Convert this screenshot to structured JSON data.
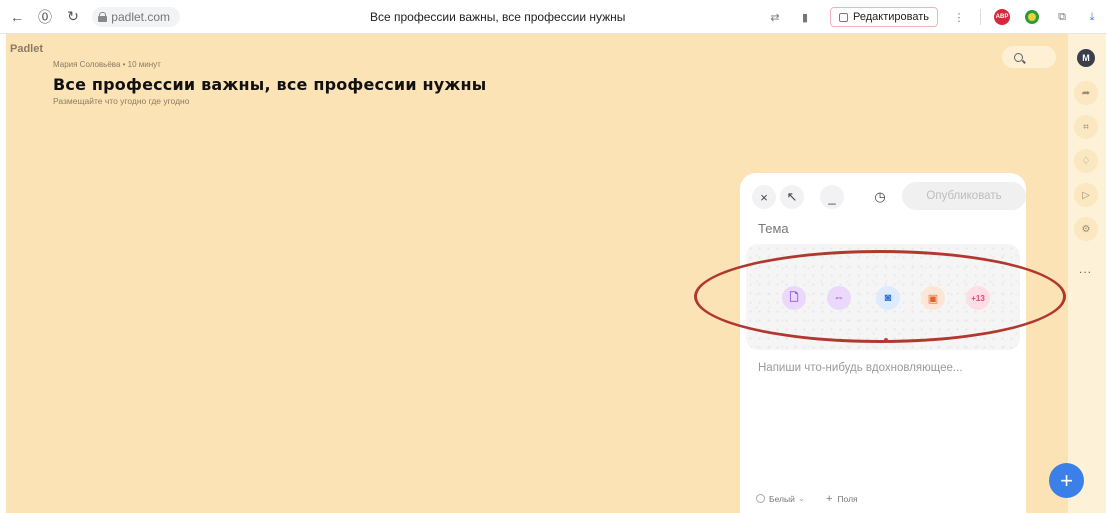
{
  "browser": {
    "url": "padlet.com",
    "tab_title": "Все профессии важны, все профессии нужны",
    "edit_label": "Редактировать",
    "adblock_badge": "ABP",
    "icons": [
      "back-arrow-icon",
      "site-info-icon",
      "reload-icon",
      "lock-icon",
      "translate-icon",
      "bookmark-icon",
      "menu-dots-icon",
      "adblock-icon",
      "extension-icon",
      "puzzle-icon"
    ]
  },
  "board": {
    "brand": "Padlet",
    "meta": "Мария Соловьёва • 10 минут",
    "title": "Все профессии важны, все профессии нужны",
    "subtitle": "Размещайте что угодно где угодно",
    "background_color": "#fbe3b6"
  },
  "rail": {
    "avatar_letter": "M",
    "icons": [
      "share-icon",
      "crop-icon",
      "bell-icon",
      "play-icon",
      "gear-icon",
      "more-icon"
    ],
    "more": "..."
  },
  "composer": {
    "close": "×",
    "expand": "↖",
    "minimize": "_",
    "publish_label": "Опубликовать",
    "topic_placeholder": "Тема",
    "body_placeholder": "Напиши что-нибудь вдохновляющее...",
    "more_count": "+13",
    "color_option": "Белый",
    "fields_option": "Поля",
    "attachments": [
      "upload-file-icon",
      "link-icon",
      "camera-icon",
      "image-search-icon",
      "more-attachments"
    ]
  },
  "fab_label": "+",
  "colors": {
    "accent": "#3b80e8",
    "annotation": "#b0382f",
    "pink": "#e8447e"
  }
}
